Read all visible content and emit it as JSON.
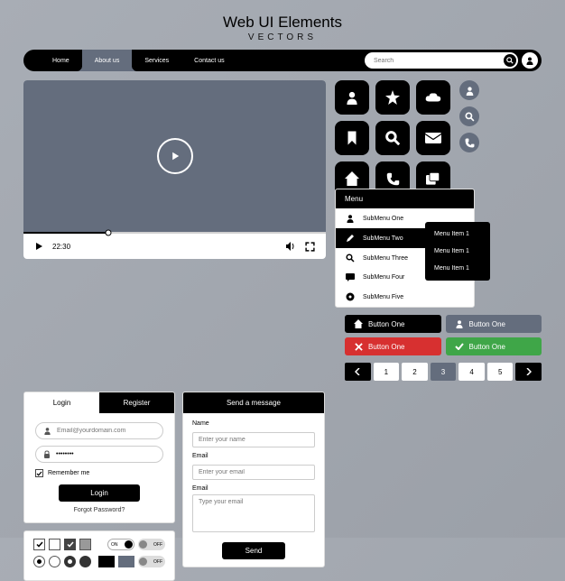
{
  "header": {
    "title": "Web UI Elements",
    "subtitle": "VECTORS"
  },
  "nav": {
    "items": [
      "Home",
      "About us",
      "Services",
      "Contact us"
    ],
    "active_index": 1,
    "search_placeholder": "Search"
  },
  "video": {
    "timestamp": "22:30"
  },
  "icon_names": [
    "person",
    "star",
    "cloud",
    "bookmark",
    "search",
    "mail",
    "home",
    "phone",
    "windows"
  ],
  "circle_icon_names": [
    "person",
    "search",
    "phone"
  ],
  "auth": {
    "tabs": [
      "Login",
      "Register"
    ],
    "email_placeholder": "Email@yourdomain.com",
    "password_value": "••••••••",
    "remember_label": "Remember me",
    "login_button": "Login",
    "forgot": "Forgot Password?"
  },
  "message": {
    "header": "Send a message",
    "name_label": "Name",
    "name_placeholder": "Enter your name",
    "email_label": "Email",
    "email_placeholder": "Enter your email",
    "msg_label": "Email",
    "msg_placeholder": "Type your email",
    "send": "Send"
  },
  "menu": {
    "title": "Menu",
    "items": [
      "SubMenu One",
      "SubMenu Two",
      "SubMenu Three",
      "SubMenu Four",
      "SubMenu Five"
    ],
    "active_index": 1,
    "flyout": [
      "Menu Item 1",
      "Menu Item 1",
      "Menu Item 1"
    ]
  },
  "buttons": {
    "label": "Button One"
  },
  "toggles": {
    "on": "ON",
    "off": "OFF"
  },
  "pagination": {
    "pages": [
      "1",
      "2",
      "3",
      "4",
      "5"
    ],
    "active_index": 2
  },
  "colors": {
    "black": "#000000",
    "slate": "#646d7d",
    "red": "#d73030",
    "green": "#3fa648"
  }
}
